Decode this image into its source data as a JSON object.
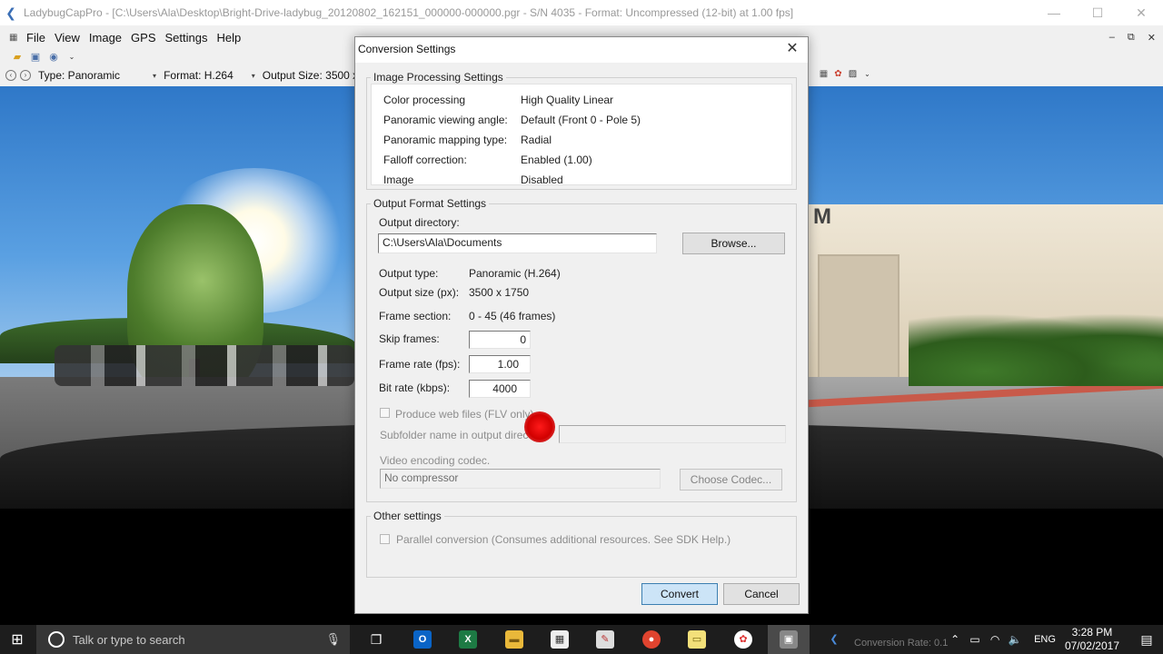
{
  "app": {
    "title": "LadybugCapPro - [C:\\Users\\Ala\\Desktop\\Bright-Drive-ladybug_20120802_162151_000000-000000.pgr - S/N 4035 - Format: Uncompressed (12-bit) at 1.00 fps]",
    "menu": [
      "File",
      "View",
      "Image",
      "GPS",
      "Settings",
      "Help"
    ],
    "toolbar": {
      "type_label": "Type: Panoramic",
      "format_label": "Format: H.264",
      "output_size_label": "Output Size: 3500 x"
    },
    "window_controls": {
      "minimize": "—",
      "maximize": "☐",
      "close": "✕"
    },
    "mdi_controls": {
      "minimize": "‒",
      "restore": "⧉",
      "close": "✕"
    },
    "scene_sign": "M"
  },
  "dialog": {
    "title": "Conversion Settings",
    "close_glyph": "✕",
    "image_processing": {
      "group_title": "Image Processing Settings",
      "rows": [
        {
          "label": "Color processing",
          "value": "High Quality Linear"
        },
        {
          "label": "Panoramic viewing angle:",
          "value": "Default (Front 0 - Pole 5)"
        },
        {
          "label": "Panoramic mapping type:",
          "value": "Radial"
        },
        {
          "label": "Falloff correction:",
          "value": "Enabled (1.00)"
        },
        {
          "label": "Image",
          "value": "Disabled"
        }
      ]
    },
    "output_format": {
      "group_title": "Output Format Settings",
      "output_directory_label": "Output directory:",
      "output_directory_value": "C:\\Users\\Ala\\Documents",
      "browse_button": "Browse...",
      "output_type_label": "Output type:",
      "output_type_value": "Panoramic (H.264)",
      "output_size_label": "Output size (px):",
      "output_size_value": "3500 x 1750",
      "frame_section_label": "Frame section:",
      "frame_section_value": "0 - 45 (46 frames)",
      "skip_frames_label": "Skip frames:",
      "skip_frames_value": "0",
      "frame_rate_label": "Frame rate (fps):",
      "frame_rate_value": "1.00",
      "bit_rate_label": "Bit rate (kbps):",
      "bit_rate_value": "4000",
      "produce_web_label": "Produce web files (FLV only)",
      "subfolder_label": "Subfolder name in output direc",
      "codec_label": "Video encoding codec.",
      "codec_value": "No compressor",
      "choose_codec_button": "Choose Codec..."
    },
    "other": {
      "group_title": "Other settings",
      "parallel_label": "Parallel conversion (Consumes additional resources. See SDK Help.)"
    },
    "convert_button": "Convert",
    "cancel_button": "Cancel"
  },
  "taskbar": {
    "search_placeholder": "Talk or type to search",
    "language": "ENG",
    "time": "3:28 PM",
    "date": "07/02/2017",
    "behind_status": "Conversion Rate: 0.1"
  }
}
